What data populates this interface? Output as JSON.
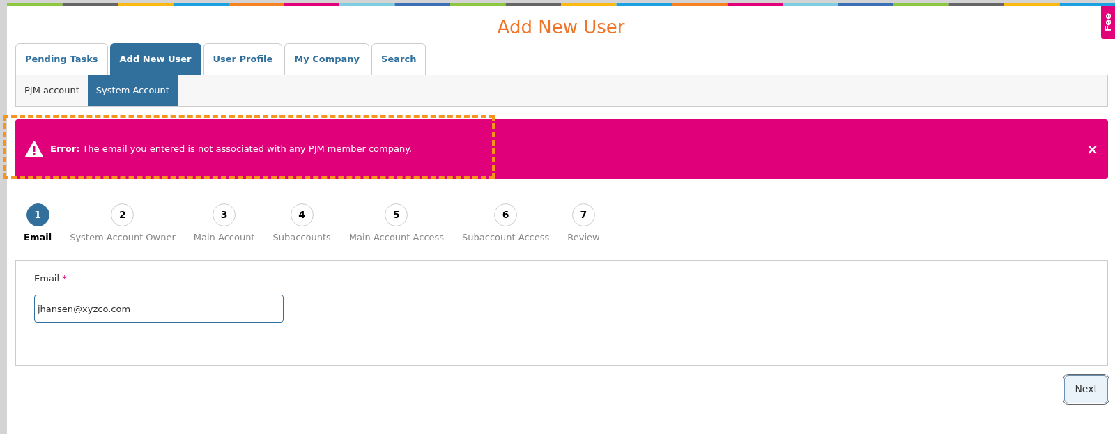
{
  "page_title": "Add New User",
  "feedback_tab": {
    "label": "Fee"
  },
  "tabs": [
    {
      "label": "Pending Tasks",
      "selected": false
    },
    {
      "label": "Add New User",
      "selected": true
    },
    {
      "label": "User Profile",
      "selected": false
    },
    {
      "label": "My Company",
      "selected": false
    },
    {
      "label": "Search",
      "selected": false
    }
  ],
  "subtabs": [
    {
      "label": "PJM account",
      "selected": false
    },
    {
      "label": "System Account",
      "selected": true
    }
  ],
  "error_banner": {
    "label": "Error:",
    "message": "The email you entered is not associated with any PJM member company.",
    "close": "×",
    "highlighted": true
  },
  "steps": [
    {
      "number": "1",
      "label": "Email",
      "selected": true
    },
    {
      "number": "2",
      "label": "System Account Owner",
      "selected": false
    },
    {
      "number": "3",
      "label": "Main Account",
      "selected": false
    },
    {
      "number": "4",
      "label": "Subaccounts",
      "selected": false
    },
    {
      "number": "5",
      "label": "Main Account Access",
      "selected": false
    },
    {
      "number": "6",
      "label": "Subaccount Access",
      "selected": false
    },
    {
      "number": "7",
      "label": "Review",
      "selected": false
    }
  ],
  "email_field": {
    "label": "Email",
    "required_mark": "*",
    "value": "jhansen@xyzco.com"
  },
  "buttons": [
    {
      "label": "Next"
    }
  ]
}
